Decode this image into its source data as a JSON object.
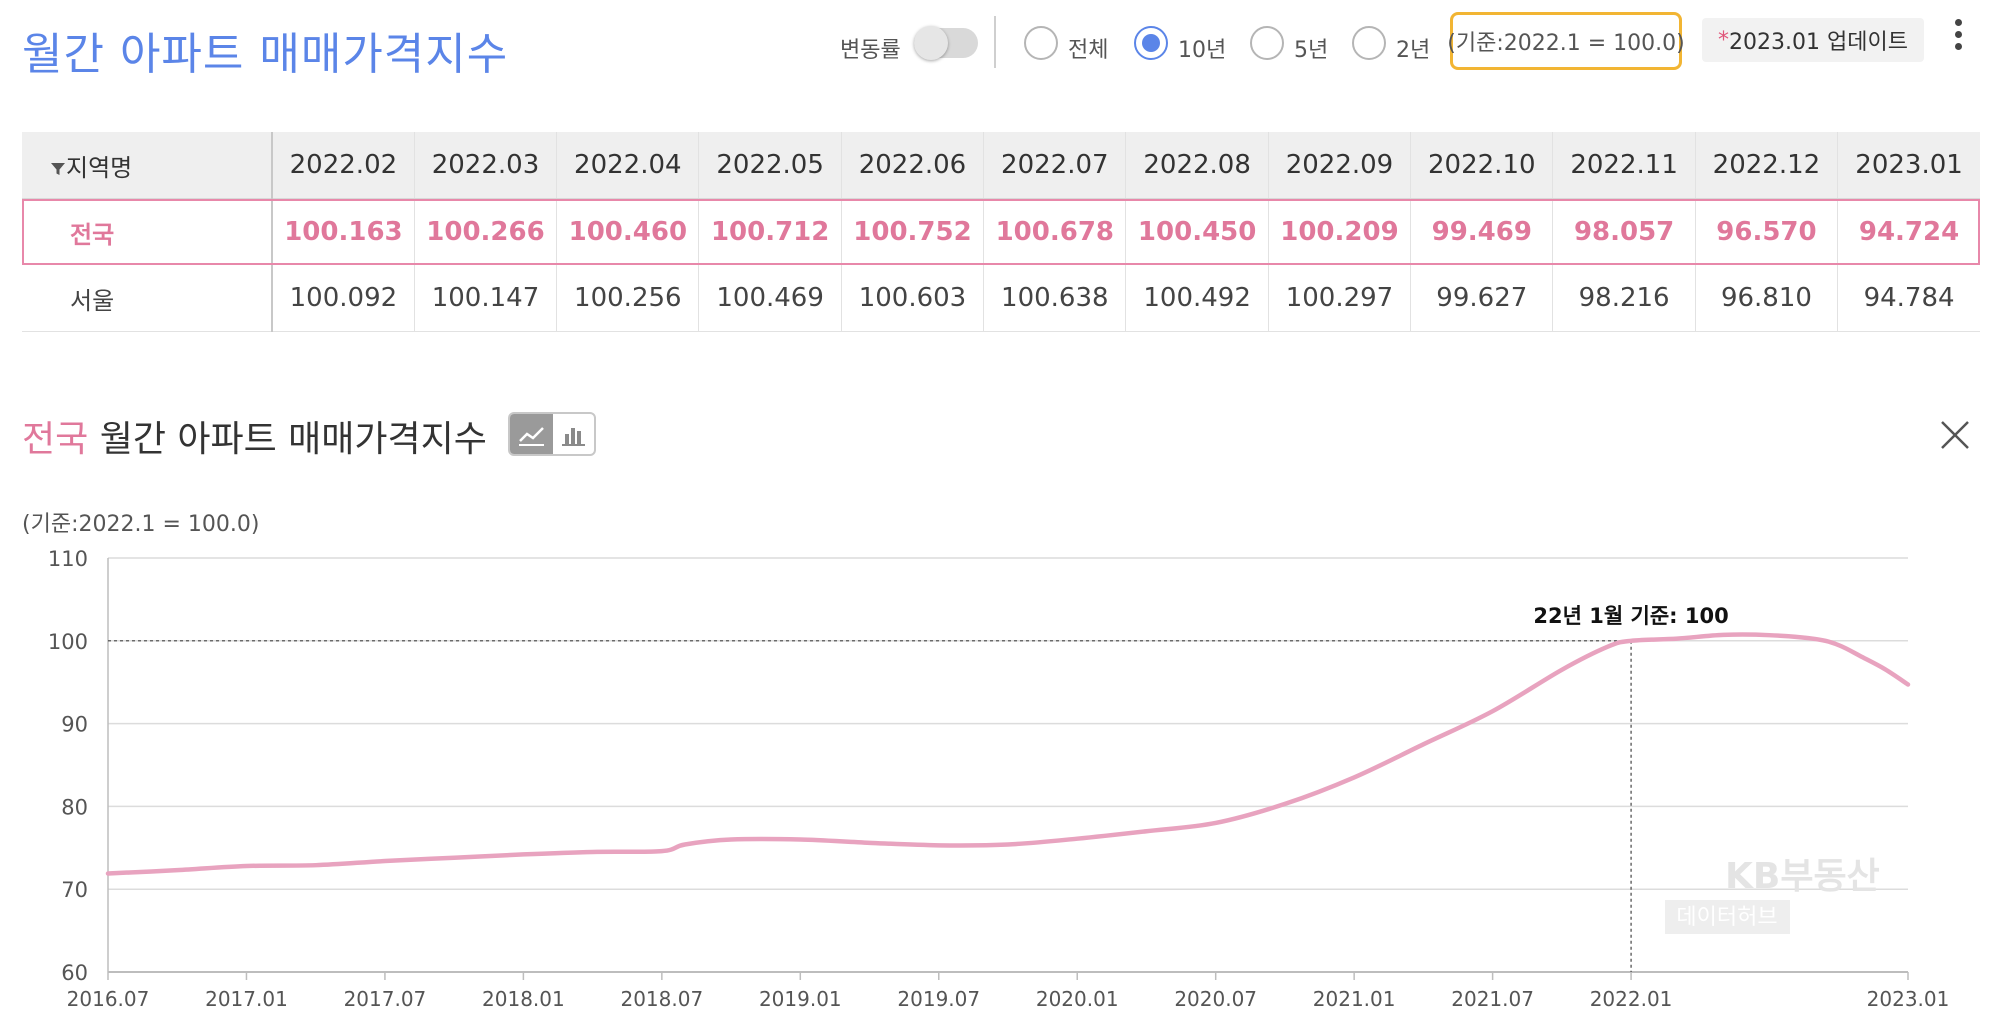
{
  "header": {
    "title": "월간 아파트 매매가격지수",
    "rate_toggle_label": "변동률",
    "period_options": [
      {
        "label": "전체",
        "selected": false
      },
      {
        "label": "10년",
        "selected": true
      },
      {
        "label": "5년",
        "selected": false
      },
      {
        "label": "2년",
        "selected": false
      }
    ],
    "base_note": "(기준:2022.1 = 100.0)",
    "update_star": "*",
    "update_label": "2023.01 업데이트"
  },
  "table": {
    "region_header": "지역명",
    "columns": [
      "2022.02",
      "2022.03",
      "2022.04",
      "2022.05",
      "2022.06",
      "2022.07",
      "2022.08",
      "2022.09",
      "2022.10",
      "2022.11",
      "2022.12",
      "2023.01"
    ],
    "rows": [
      {
        "region": "전국",
        "highlighted": true,
        "values": [
          "100.163",
          "100.266",
          "100.460",
          "100.712",
          "100.752",
          "100.678",
          "100.450",
          "100.209",
          "99.469",
          "98.057",
          "96.570",
          "94.724"
        ]
      },
      {
        "region": "서울",
        "highlighted": false,
        "values": [
          "100.092",
          "100.147",
          "100.256",
          "100.469",
          "100.603",
          "100.638",
          "100.492",
          "100.297",
          "99.627",
          "98.216",
          "96.810",
          "94.784"
        ]
      }
    ]
  },
  "chart_section": {
    "title_region": "전국",
    "title_rest": " 월간 아파트 매매가격지수",
    "base_note": "(기준:2022.1 = 100.0)",
    "view_mode": "line"
  },
  "chart_data": {
    "type": "line",
    "title": "",
    "xlabel": "",
    "ylabel": "",
    "ylim": [
      60,
      110
    ],
    "yticks": [
      60,
      70,
      80,
      90,
      100,
      110
    ],
    "ytick_labels": [
      "60",
      "70",
      "80",
      "90",
      "100",
      "110"
    ],
    "xticks": [
      "2016.07",
      "2017.01",
      "2017.07",
      "2018.01",
      "2018.07",
      "2019.01",
      "2019.07",
      "2020.01",
      "2020.07",
      "2021.01",
      "2021.07",
      "2022.01",
      "2023.01"
    ],
    "grid": true,
    "reference_annotation": {
      "x": "2022.01",
      "y": 100,
      "label": "22년 1월 기준: 100"
    },
    "watermark": [
      "KB부동산",
      "데이터허브"
    ],
    "line_color": "#e8a3bf",
    "series": [
      {
        "name": "전국",
        "x": [
          "2016.07",
          "2016.10",
          "2017.01",
          "2017.04",
          "2017.07",
          "2017.10",
          "2018.01",
          "2018.04",
          "2018.07",
          "2018.08",
          "2018.10",
          "2019.01",
          "2019.04",
          "2019.07",
          "2019.10",
          "2020.01",
          "2020.04",
          "2020.07",
          "2020.10",
          "2021.01",
          "2021.04",
          "2021.07",
          "2021.10",
          "2021.12",
          "2022.01",
          "2022.03",
          "2022.05",
          "2022.07",
          "2022.09",
          "2022.10",
          "2022.11",
          "2022.12",
          "2023.01"
        ],
        "values": [
          71.9,
          72.3,
          72.8,
          72.9,
          73.4,
          73.8,
          74.2,
          74.5,
          74.6,
          75.4,
          76.0,
          76.0,
          75.6,
          75.3,
          75.4,
          76.1,
          77.0,
          78.0,
          80.3,
          83.5,
          87.5,
          91.5,
          96.5,
          99.3,
          100.0,
          100.266,
          100.712,
          100.678,
          100.209,
          99.469,
          98.057,
          96.57,
          94.724
        ]
      }
    ]
  }
}
